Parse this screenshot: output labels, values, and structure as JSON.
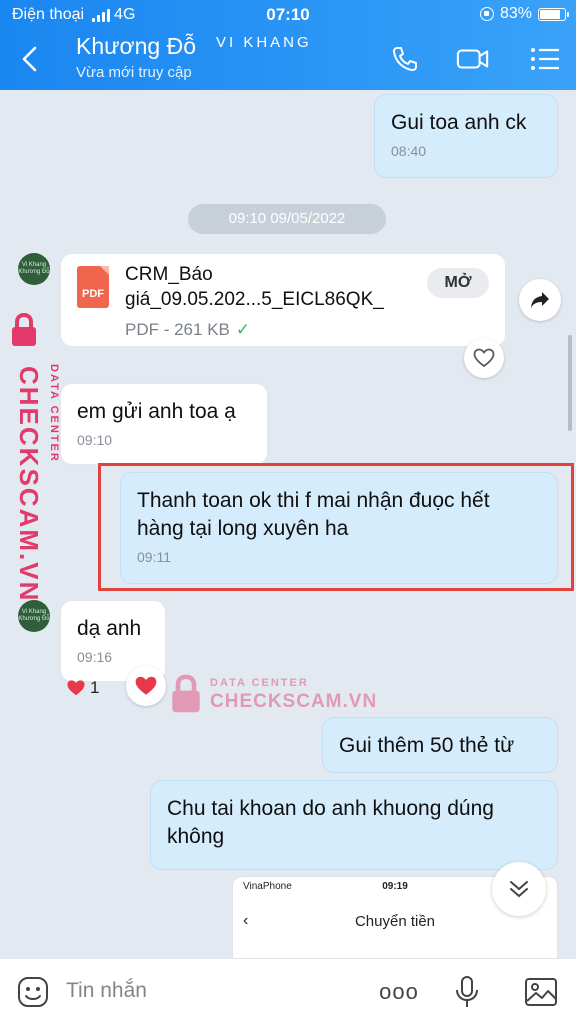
{
  "status_bar": {
    "carrier": "Điện thoại",
    "network": "4G",
    "time": "07:10",
    "battery": "83%"
  },
  "header": {
    "contact_name": "Khương Đỗ",
    "contact_tag": "VI KHANG",
    "contact_status": "Vừa mới truy cập",
    "icons": [
      "back-icon",
      "phone-icon",
      "video-call-icon",
      "menu-icon"
    ]
  },
  "chat": {
    "avatar_text": [
      "Vi Khang",
      "Khương Đỗ"
    ],
    "messages": [
      {
        "from": "me",
        "text": "Gui toa anh ck",
        "time": "08:40"
      },
      {
        "from": "them",
        "text": "em gửi anh toa ạ",
        "time": "09:10"
      },
      {
        "from": "me",
        "text": "Thanh toan ok thi f mai nhận đuọc hết hàng tại long xuyên ha",
        "time": "09:11"
      },
      {
        "from": "them",
        "text": "dạ anh",
        "time": "09:16"
      },
      {
        "from": "me",
        "text": "Gui thêm 50 thẻ từ",
        "time": ""
      },
      {
        "from": "me",
        "text": "Chu tai khoan do anh khuong dúng không",
        "time": ""
      }
    ],
    "date_divider": "09:10 09/05/2022",
    "file": {
      "name": "CRM_Báo giá_09.05.202...5_EICL86QK_",
      "meta": "PDF - 261 KB",
      "type_label": "PDF",
      "open_label": "MỞ"
    },
    "reaction": {
      "emoji": "heart",
      "count": "1"
    },
    "screenshot_preview": {
      "carrier": "VinaPhone",
      "time": "09:19",
      "title": "Chuyển tiền"
    }
  },
  "watermark": {
    "small": "DATA CENTER",
    "big": "CHECKSCAM.VN"
  },
  "input_bar": {
    "placeholder": "Tin nhắn",
    "more_label": "ooo"
  },
  "colors": {
    "header": "#1a86f0",
    "sent_bubble": "#d5ecfd",
    "received_bubble": "#ffffff",
    "watermark": "#e33a6b",
    "highlight": "#e0433c"
  }
}
